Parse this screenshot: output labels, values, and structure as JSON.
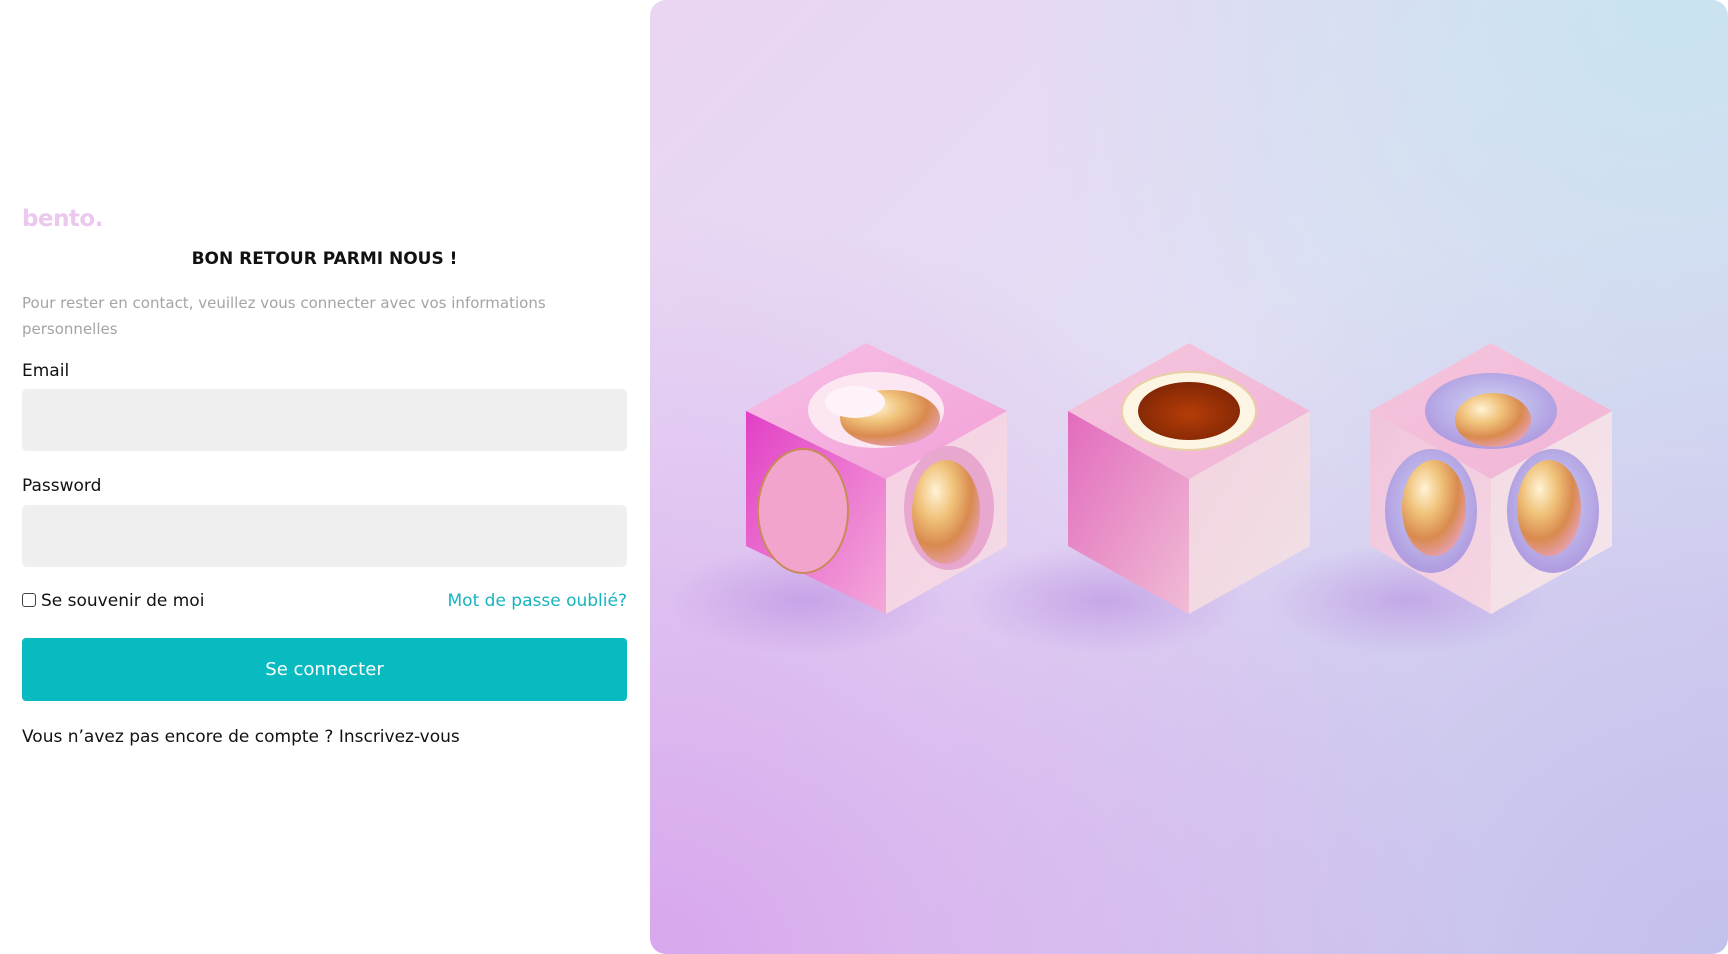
{
  "brand": {
    "logo_text": "bento."
  },
  "login": {
    "title": "BON RETOUR PARMI NOUS !",
    "subtitle": "Pour rester en contact, veuillez vous connecter avec vos informations personnelles",
    "email_label": "Email",
    "email_value": "",
    "password_label": "Password",
    "password_value": "",
    "remember_label": "Se souvenir de moi",
    "remember_checked": false,
    "forgot_label": "Mot de passe oublié?",
    "submit_label": "Se connecter",
    "signup_prompt": "Vous n’avez pas encore de compte ?",
    "signup_link": "Inscrivez-vous"
  },
  "hero": {
    "image": "three-pink-cubes-with-gold-spheres-illustration"
  },
  "colors": {
    "accent": "#08bbc0",
    "link": "#17b4bf",
    "logo": "#ecc8ef",
    "input_bg": "#efefef",
    "muted_text": "#a4a4a4"
  }
}
